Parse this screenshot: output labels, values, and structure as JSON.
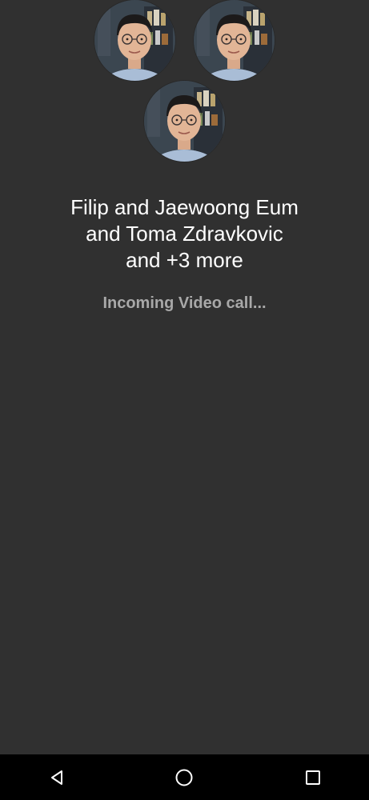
{
  "call": {
    "caller_line_1": "Filip and Jaewoong Eum",
    "caller_line_2": "and Toma Zdravkovic",
    "caller_line_3": "and +3 more",
    "status": "Incoming Video call..."
  },
  "avatars": [
    {
      "name": "participant-avatar-1",
      "icon": "person-photo"
    },
    {
      "name": "participant-avatar-2",
      "icon": "person-photo"
    },
    {
      "name": "participant-avatar-3",
      "icon": "person-photo"
    }
  ],
  "navbar": {
    "back_icon": "back-triangle-icon",
    "home_icon": "home-circle-icon",
    "recents_icon": "recents-square-icon"
  },
  "colors": {
    "background": "#303030",
    "title_text": "#ffffff",
    "status_text": "#a8a8a8",
    "navbar": "#000000"
  }
}
